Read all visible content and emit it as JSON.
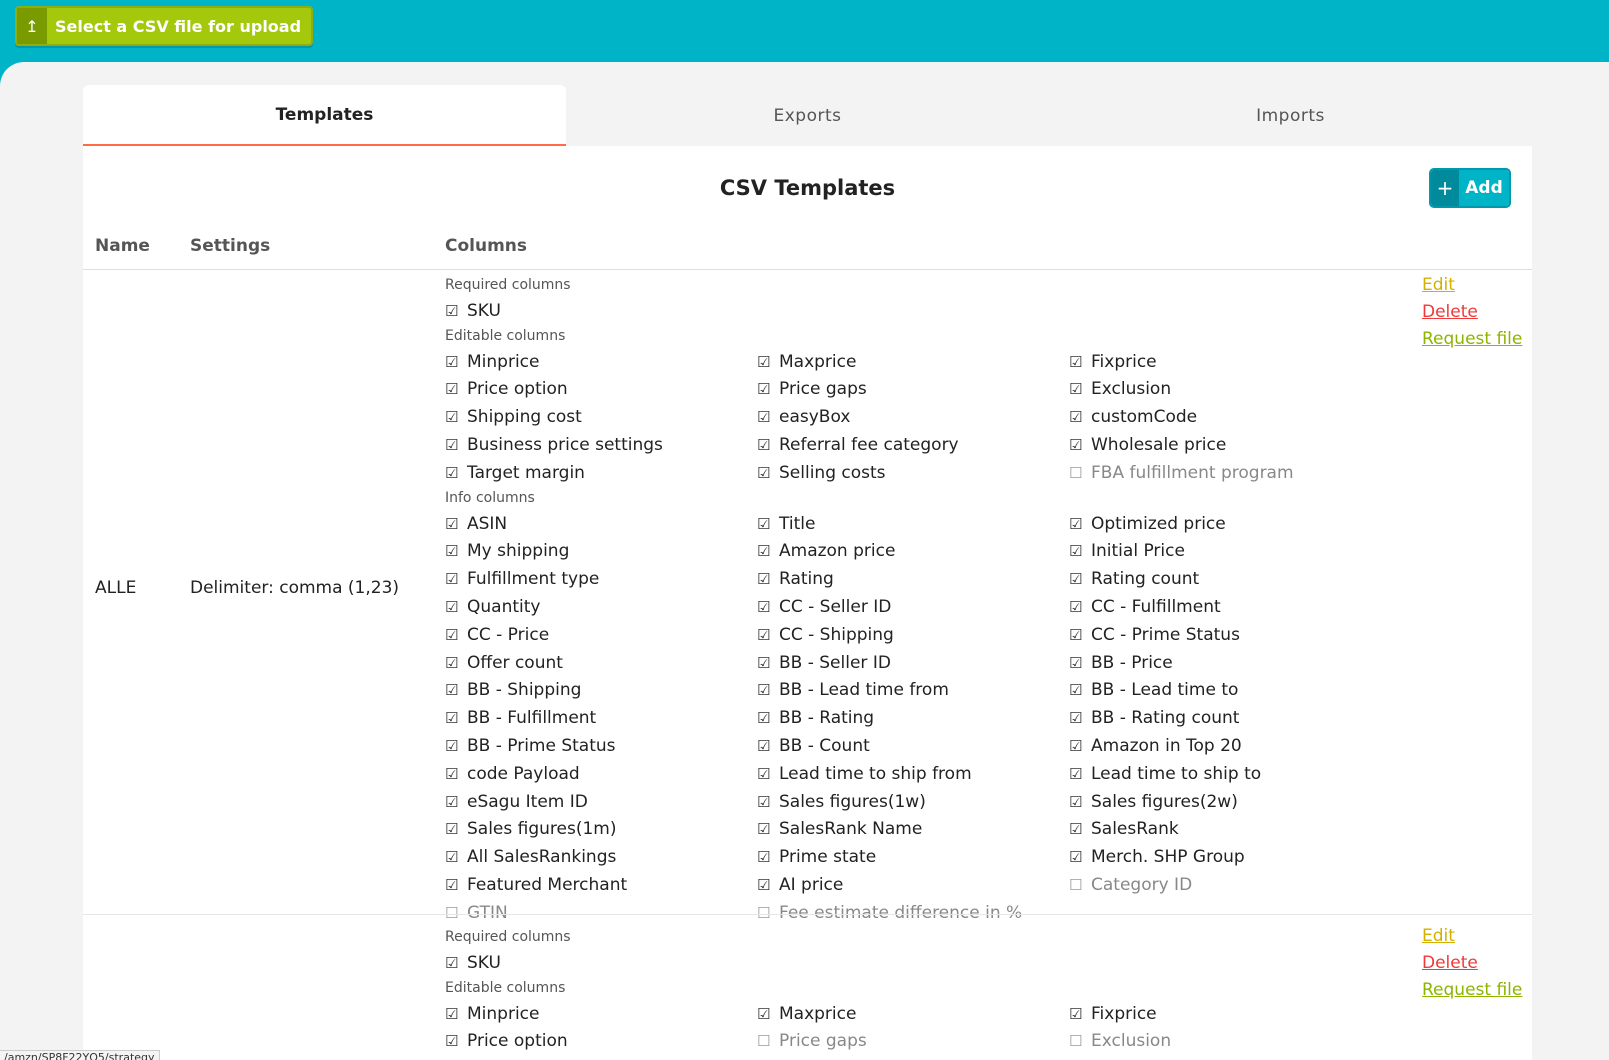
{
  "header": {
    "upload_icon": "upload-arrow-icon",
    "upload_label": "Select a CSV file for upload"
  },
  "tabs": [
    {
      "label": "Templates",
      "active": true
    },
    {
      "label": "Exports",
      "active": false
    },
    {
      "label": "Imports",
      "active": false
    }
  ],
  "panel": {
    "title": "CSV Templates",
    "add_label": "Add",
    "add_icon": "plus-icon"
  },
  "table_headers": [
    "Name",
    "Settings",
    "Columns"
  ],
  "section_labels": {
    "required": "Required columns",
    "editable": "Editable columns",
    "info": "Info columns"
  },
  "action_labels": {
    "edit": "Edit",
    "delete": "Delete",
    "request": "Request file"
  },
  "rows": [
    {
      "name": "ALLE",
      "settings": "Delimiter: comma (1,23)",
      "required": [
        {
          "label": "SKU",
          "checked": true
        }
      ],
      "editable": [
        {
          "label": "Minprice",
          "checked": true
        },
        {
          "label": "Maxprice",
          "checked": true
        },
        {
          "label": "Fixprice",
          "checked": true
        },
        {
          "label": "Price option",
          "checked": true
        },
        {
          "label": "Price gaps",
          "checked": true
        },
        {
          "label": "Exclusion",
          "checked": true
        },
        {
          "label": "Shipping cost",
          "checked": true
        },
        {
          "label": "easyBox",
          "checked": true
        },
        {
          "label": "customCode",
          "checked": true
        },
        {
          "label": "Business price settings",
          "checked": true
        },
        {
          "label": "Referral fee category",
          "checked": true
        },
        {
          "label": "Wholesale price",
          "checked": true
        },
        {
          "label": "Target margin",
          "checked": true
        },
        {
          "label": "Selling costs",
          "checked": true
        },
        {
          "label": "FBA fulfillment program",
          "checked": false
        }
      ],
      "info": [
        {
          "label": "ASIN",
          "checked": true
        },
        {
          "label": "Title",
          "checked": true
        },
        {
          "label": "Optimized price",
          "checked": true
        },
        {
          "label": "My shipping",
          "checked": true
        },
        {
          "label": "Amazon price",
          "checked": true
        },
        {
          "label": "Initial Price",
          "checked": true
        },
        {
          "label": "Fulfillment type",
          "checked": true
        },
        {
          "label": "Rating",
          "checked": true
        },
        {
          "label": "Rating count",
          "checked": true
        },
        {
          "label": "Quantity",
          "checked": true
        },
        {
          "label": "CC - Seller ID",
          "checked": true
        },
        {
          "label": "CC - Fulfillment",
          "checked": true
        },
        {
          "label": "CC - Price",
          "checked": true
        },
        {
          "label": "CC - Shipping",
          "checked": true
        },
        {
          "label": "CC - Prime Status",
          "checked": true
        },
        {
          "label": "Offer count",
          "checked": true
        },
        {
          "label": "BB - Seller ID",
          "checked": true
        },
        {
          "label": "BB - Price",
          "checked": true
        },
        {
          "label": "BB - Shipping",
          "checked": true
        },
        {
          "label": "BB - Lead time from",
          "checked": true
        },
        {
          "label": "BB - Lead time to",
          "checked": true
        },
        {
          "label": "BB - Fulfillment",
          "checked": true
        },
        {
          "label": "BB - Rating",
          "checked": true
        },
        {
          "label": "BB - Rating count",
          "checked": true
        },
        {
          "label": "BB - Prime Status",
          "checked": true
        },
        {
          "label": "BB - Count",
          "checked": true
        },
        {
          "label": "Amazon in Top 20",
          "checked": true
        },
        {
          "label": "code Payload",
          "checked": true
        },
        {
          "label": "Lead time to ship from",
          "checked": true
        },
        {
          "label": "Lead time to ship to",
          "checked": true
        },
        {
          "label": "eSagu Item ID",
          "checked": true
        },
        {
          "label": "Sales figures(1w)",
          "checked": true
        },
        {
          "label": "Sales figures(2w)",
          "checked": true
        },
        {
          "label": "Sales figures(1m)",
          "checked": true
        },
        {
          "label": "SalesRank Name",
          "checked": true
        },
        {
          "label": "SalesRank",
          "checked": true
        },
        {
          "label": "All SalesRankings",
          "checked": true
        },
        {
          "label": "Prime state",
          "checked": true
        },
        {
          "label": "Merch. SHP Group",
          "checked": true
        },
        {
          "label": "Featured Merchant",
          "checked": true
        },
        {
          "label": "AI price",
          "checked": true
        },
        {
          "label": "Category ID",
          "checked": false
        },
        {
          "label": "GTIN",
          "checked": false
        },
        {
          "label": "Fee estimate difference in %",
          "checked": false
        }
      ]
    },
    {
      "name": "",
      "settings": "",
      "required": [
        {
          "label": "SKU",
          "checked": true
        }
      ],
      "editable": [
        {
          "label": "Minprice",
          "checked": true
        },
        {
          "label": "Maxprice",
          "checked": true
        },
        {
          "label": "Fixprice",
          "checked": true
        },
        {
          "label": "Price option",
          "checked": true
        },
        {
          "label": "Price gaps",
          "checked": false
        },
        {
          "label": "Exclusion",
          "checked": false
        }
      ],
      "info": []
    }
  ],
  "status_bar_url": "/amzn/SP8F22YQ5/strategy",
  "colors": {
    "topbar": "#00b4c8",
    "upload_button": "#a4c80c",
    "tab_accent": "#ff6b45",
    "add_button": "#00b4c8",
    "edit_link": "#d4b100",
    "delete_link": "#ee3a3a",
    "request_link": "#8cb400"
  }
}
